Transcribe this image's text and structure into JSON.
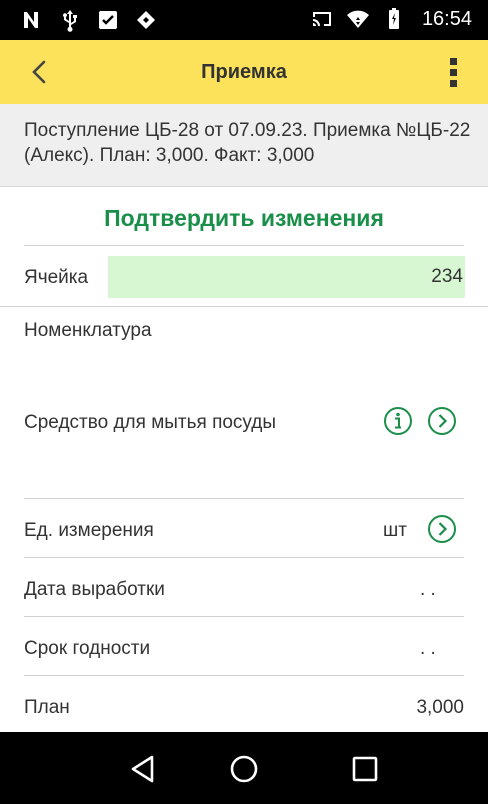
{
  "status_bar": {
    "time": "16:54",
    "left_icons": [
      "n-icon",
      "usb-icon",
      "checkbox-icon",
      "diamond-icon"
    ],
    "right_icons": [
      "cast-icon",
      "wifi-icon",
      "battery-icon"
    ]
  },
  "app_bar": {
    "title": "Приемка",
    "back_icon": "chevron-left-icon",
    "menu_icon": "more-vert-icon"
  },
  "info": {
    "text": "Поступление ЦБ-28 от 07.09.23. Приемка №ЦБ-22 (Алекс). План: 3,000. Факт: 3,000"
  },
  "confirm_label": "Подтвердить изменения",
  "form": {
    "cell": {
      "label": "Ячейка",
      "value": "234"
    },
    "nomenclature": {
      "label": "Номенклатура",
      "value": "Средство для мытья посуды"
    },
    "unit": {
      "label": "Ед. измерения",
      "value": "шт"
    },
    "production_date": {
      "label": "Дата выработки",
      "value": ". ."
    },
    "expiry_date": {
      "label": "Срок годности",
      "value": ". ."
    },
    "plan": {
      "label": "План",
      "value": "3,000"
    }
  },
  "nav_bar": {
    "icons": [
      "back-triangle-icon",
      "home-circle-icon",
      "recents-square-icon"
    ]
  },
  "colors": {
    "accent": "#1a8f4a",
    "app_bar": "#fbe25a",
    "cell_field": "#d7f7d3",
    "info_bg": "#efefef"
  }
}
